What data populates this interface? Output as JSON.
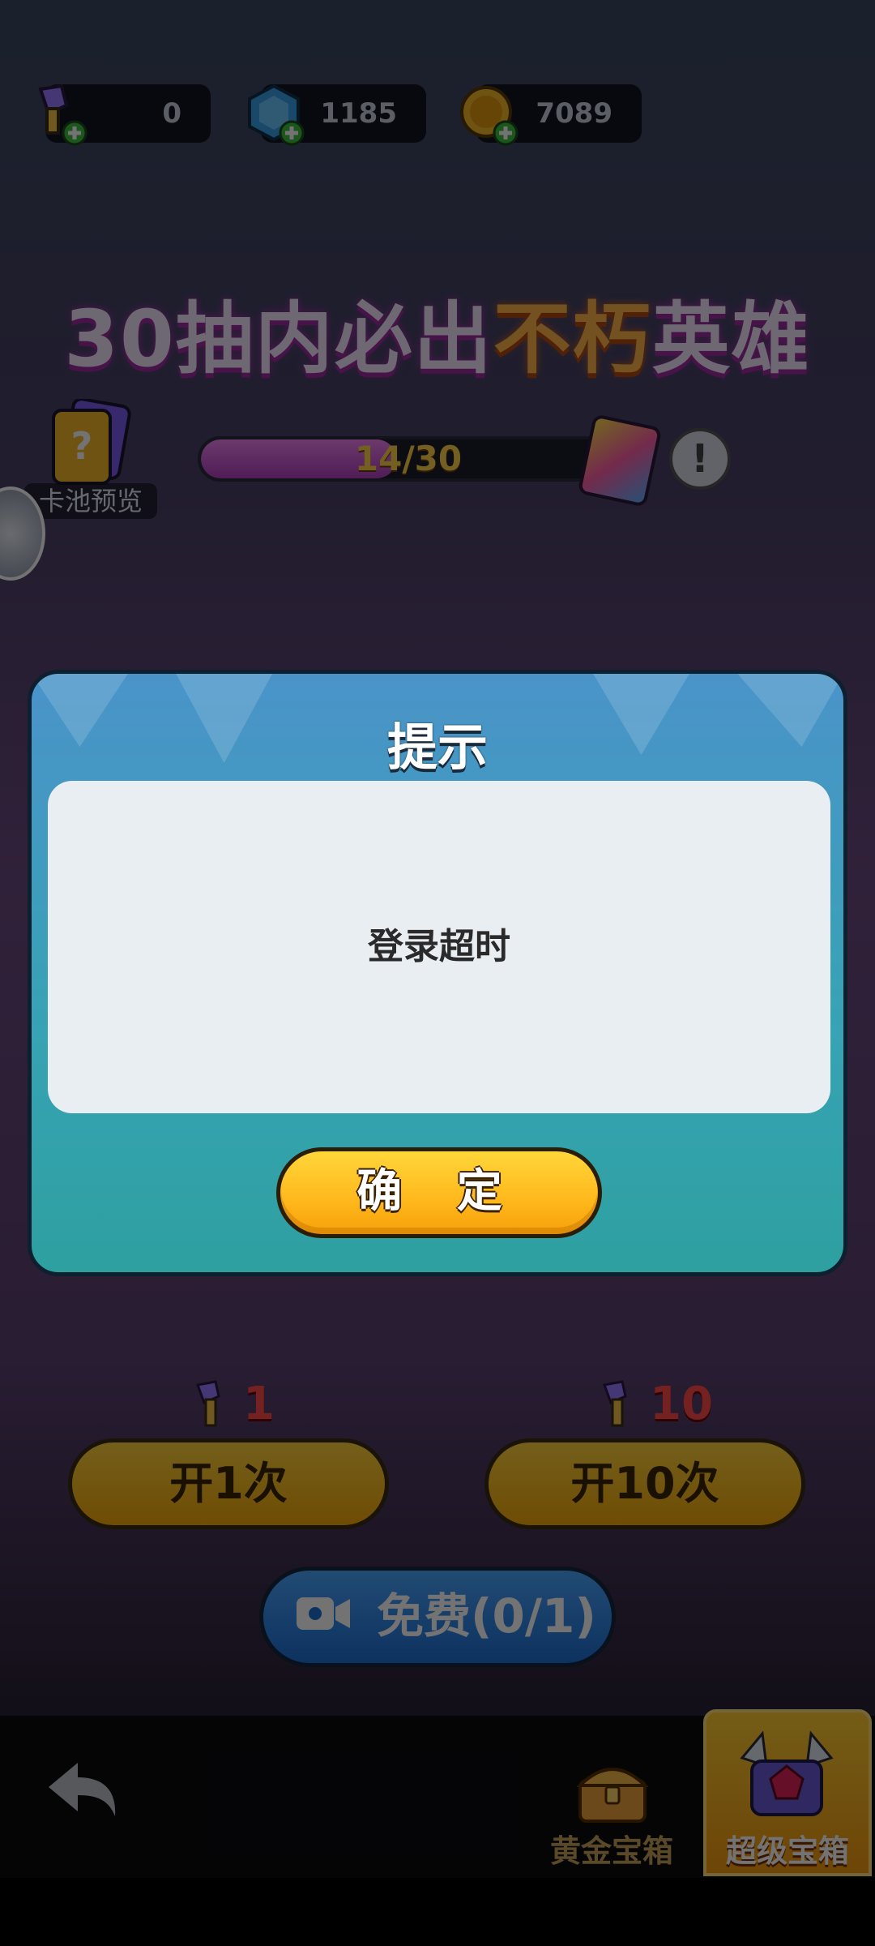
{
  "currencies": [
    {
      "name": "key",
      "value": "0"
    },
    {
      "name": "gem",
      "value": "1185"
    },
    {
      "name": "coin",
      "value": "7089"
    }
  ],
  "headline": {
    "prefix": "30抽内必出",
    "highlight": "不朽",
    "suffix": "英雄"
  },
  "pool_preview": {
    "label": "卡池预览"
  },
  "progress": {
    "text": "14/30",
    "current": 14,
    "total": 30
  },
  "open_once": {
    "cost": "1",
    "label": "开1次"
  },
  "open_ten": {
    "cost": "10",
    "label": "开10次"
  },
  "free": {
    "label": "免费(0/1)"
  },
  "nav": {
    "gold_chest": "黄金宝箱",
    "super_chest": "超级宝箱"
  },
  "dialog": {
    "title": "提示",
    "message": "登录超时",
    "confirm": "确 定"
  },
  "colors": {
    "accent": "#ffc21c",
    "dialog": "#3a9fb8",
    "headline_highlight": "#ffb347"
  }
}
